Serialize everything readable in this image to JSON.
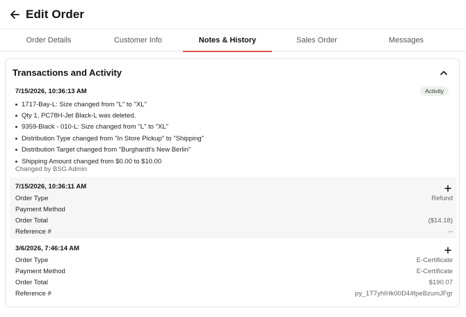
{
  "header": {
    "title": "Edit Order",
    "back_icon": "arrow-left-icon"
  },
  "tabs": [
    {
      "label": "Order Details",
      "active": false
    },
    {
      "label": "Customer Info",
      "active": false
    },
    {
      "label": "Notes & History",
      "active": true
    },
    {
      "label": "Sales Order",
      "active": false
    },
    {
      "label": "Messages",
      "active": false
    }
  ],
  "accent_color": "#d9534f",
  "section": {
    "title": "Transactions and Activity",
    "activity": {
      "timestamp": "7/15/2026, 10:36:13 AM",
      "badge": "Activity",
      "changes": [
        "1717-Bay-L: Size changed from \"L\" to \"XL\"",
        "Qty 1, PC78H-Jet Black-L was deleted.",
        "9359-Black - 010-L: Size changed from \"L\" to \"XL\"",
        "Distribution Type changed from \"In Store Pickup\" to \"Shipping\"",
        "Distribution Target changed from \"Burghardt's New Berlin\"",
        "Shipping Amount changed from $0.00 to $10.00"
      ],
      "changed_by": "Changed by BSG Admin"
    },
    "transactions": [
      {
        "timestamp": "7/15/2026, 10:36:11 AM",
        "rows": [
          {
            "label": "Order Type",
            "value": "Refund"
          },
          {
            "label": "Payment Method",
            "value": ""
          },
          {
            "label": "Order Total",
            "value": "($14.18)"
          },
          {
            "label": "Reference #",
            "value": "--"
          }
        ]
      },
      {
        "timestamp": "3/6/2026, 7:46:14 AM",
        "rows": [
          {
            "label": "Order Type",
            "value": "E-Certificate"
          },
          {
            "label": "Payment Method",
            "value": "E-Certificate"
          },
          {
            "label": "Order Total",
            "value": "$190.07"
          },
          {
            "label": "Reference #",
            "value": "py_1T7yhIHk00D44fpeBzumJFgr"
          }
        ]
      }
    ]
  }
}
